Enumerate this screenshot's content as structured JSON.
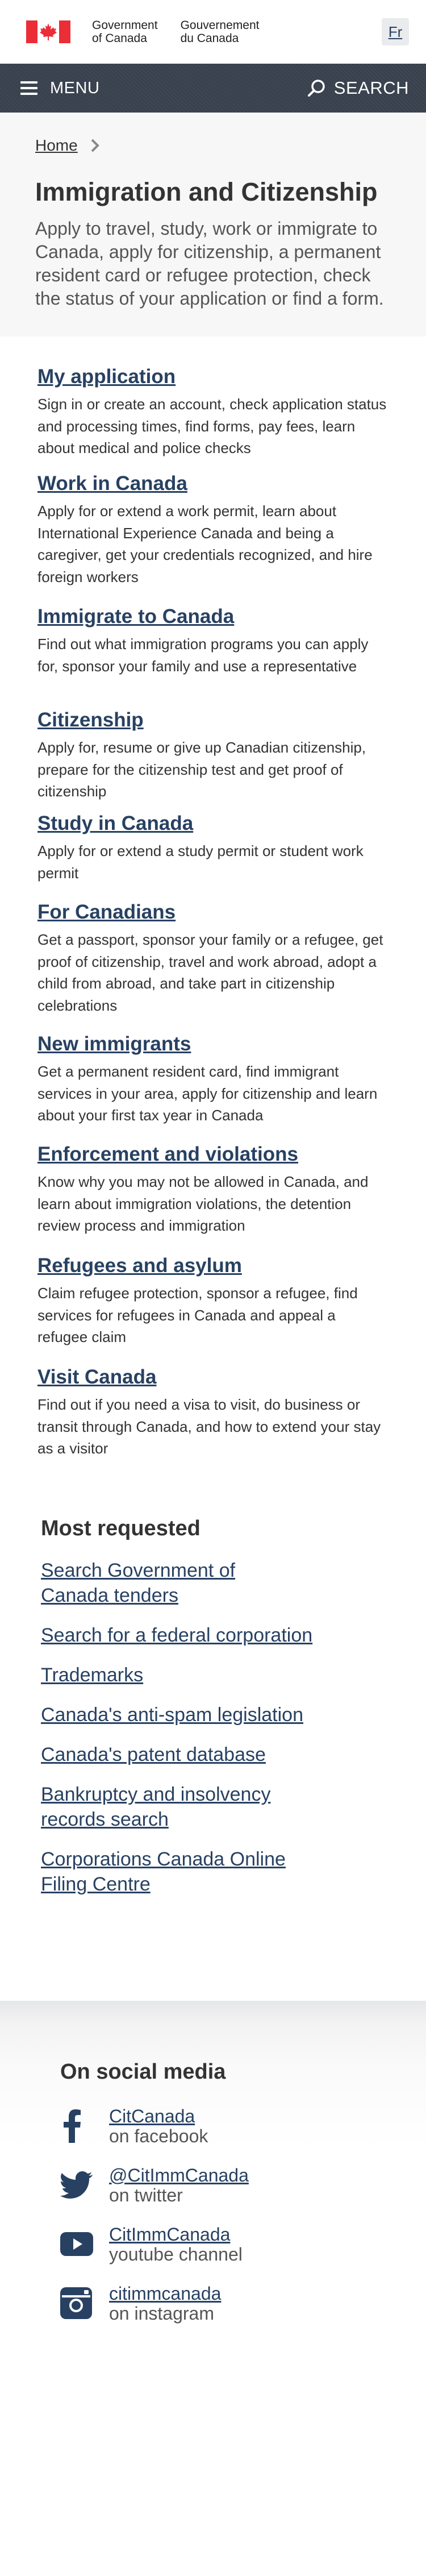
{
  "header": {
    "signature_en_1": "Government",
    "signature_en_2": "of Canada",
    "signature_fr_1": "Gouvernement",
    "signature_fr_2": "du Canada",
    "language_toggle": "Fr",
    "flag_colors": {
      "red": "#eb2d37",
      "white": "#ffffff"
    }
  },
  "menu_bar": {
    "menu_label": "MENU",
    "search_label": "SEARCH",
    "background": "#38414d"
  },
  "breadcrumb": {
    "items": [
      {
        "label": "Home"
      }
    ]
  },
  "page": {
    "title": "Immigration and Citizenship",
    "intro": "Apply to travel, study, work or immigrate to Canada, apply for citizenship, a permanent resident card or refugee protection, check the status of your application or find a form."
  },
  "services": [
    {
      "title": "My application",
      "description": "Sign in or create an account, check application status and processing times, find forms, pay fees, learn about medical and police checks"
    },
    {
      "title": "Work in Canada",
      "description": "Apply for or extend a work permit, learn about International Experience Canada and being a caregiver, get your credentials recognized, and hire foreign workers"
    },
    {
      "title": "Immigrate to Canada",
      "description": "Find out what immigration programs you can apply for, sponsor your family and use a representative"
    },
    {
      "title": "Citizenship",
      "description": "Apply for, resume or give up Canadian citizenship, prepare for the citizenship test and get proof of citizenship"
    },
    {
      "title": "Study in Canada",
      "description": "Apply for or extend a study permit or student work permit"
    },
    {
      "title": "For Canadians",
      "description": "Get a passport, sponsor your family or a refugee, get proof of citizenship, travel and work abroad, adopt a child from abroad, and take part in citizenship celebrations"
    },
    {
      "title": "New immigrants",
      "description": "Get a permanent resident card, find immigrant services in your area, apply for citizenship and learn about your first tax year in Canada"
    },
    {
      "title": "Enforcement and violations",
      "description": "Know why you may not be allowed in Canada, and learn about immigration violations, the detention review process and immigration"
    },
    {
      "title": "Refugees and asylum",
      "description": "Claim refugee protection, sponsor a refugee, find services for refugees in Canada and appeal a refugee claim"
    },
    {
      "title": "Visit Canada",
      "description": "Find out if you need a visa to visit, do business or transit through Canada, and how to extend your stay as a visitor"
    }
  ],
  "most_requested": {
    "heading": "Most requested",
    "links": [
      "Search Government of Canada tenders",
      "Search for a federal corporation",
      "Trademarks",
      "Canada's anti-spam legislation",
      "Canada's patent database",
      "Bankruptcy and insolvency records search",
      "Corporations Canada Online Filing Centre"
    ]
  },
  "social": {
    "heading": "On social media",
    "items": [
      {
        "icon": "facebook-icon",
        "name": "CitCanada",
        "sub": "on facebook"
      },
      {
        "icon": "twitter-icon",
        "name": "@CitImmCanada",
        "sub": "on twitter"
      },
      {
        "icon": "youtube-icon",
        "name": "CitImmCanada",
        "sub": "youtube channel"
      },
      {
        "icon": "instagram-icon",
        "name": "citimmcanada",
        "sub": "on instagram"
      }
    ],
    "icon_color": "#284162"
  }
}
